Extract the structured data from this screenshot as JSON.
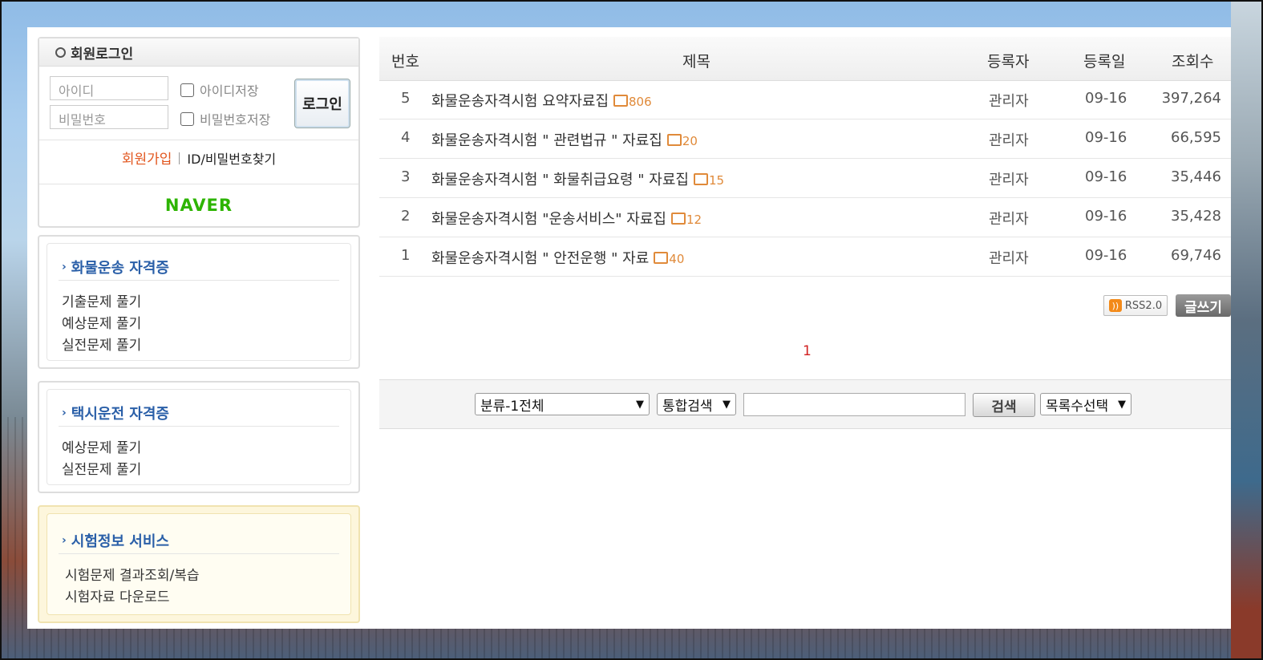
{
  "login": {
    "title": "회원로그인",
    "id_placeholder": "아이디",
    "pw_placeholder": "비밀번호",
    "save_id": "아이디저장",
    "save_pw": "비밀번호저장",
    "login_button": "로그인",
    "join": "회원가입",
    "find": "ID/비밀번호찾기",
    "naver": "NAVER"
  },
  "menus": [
    {
      "title": "화물운송 자격증",
      "items": [
        "기출문제 풀기",
        "예상문제 풀기",
        "실전문제 풀기"
      ]
    },
    {
      "title": "택시운전 자격증",
      "items": [
        "예상문제 풀기",
        "실전문제 풀기"
      ]
    },
    {
      "title": "시험정보 서비스",
      "items": [
        "시험문제 결과조회/복습",
        "시험자료 다운로드"
      ]
    }
  ],
  "board": {
    "headers": {
      "num": "번호",
      "title": "제목",
      "author": "등록자",
      "date": "등록일",
      "views": "조회수"
    },
    "rows": [
      {
        "num": "5",
        "title": "화물운송자격시험 요약자료집",
        "comments": "806",
        "author": "관리자",
        "date": "09-16",
        "views": "397,264"
      },
      {
        "num": "4",
        "title": "화물운송자격시험 \" 관련법규 \" 자료집",
        "comments": "20",
        "author": "관리자",
        "date": "09-16",
        "views": "66,595"
      },
      {
        "num": "3",
        "title": "화물운송자격시험 \" 화물취급요령 \" 자료집",
        "comments": "15",
        "author": "관리자",
        "date": "09-16",
        "views": "35,446"
      },
      {
        "num": "2",
        "title": "화물운송자격시험 \"운송서비스\" 자료집",
        "comments": "12",
        "author": "관리자",
        "date": "09-16",
        "views": "35,428"
      },
      {
        "num": "1",
        "title": "화물운송자격시험 \" 안전운행 \" 자료",
        "comments": "40",
        "author": "관리자",
        "date": "09-16",
        "views": "69,746"
      }
    ],
    "rss": "RSS2.0",
    "write": "글쓰기",
    "page": "1"
  },
  "search": {
    "category": "분류-1전체",
    "scope": "통합검색",
    "button": "검색",
    "list_count": "목록수선택"
  }
}
